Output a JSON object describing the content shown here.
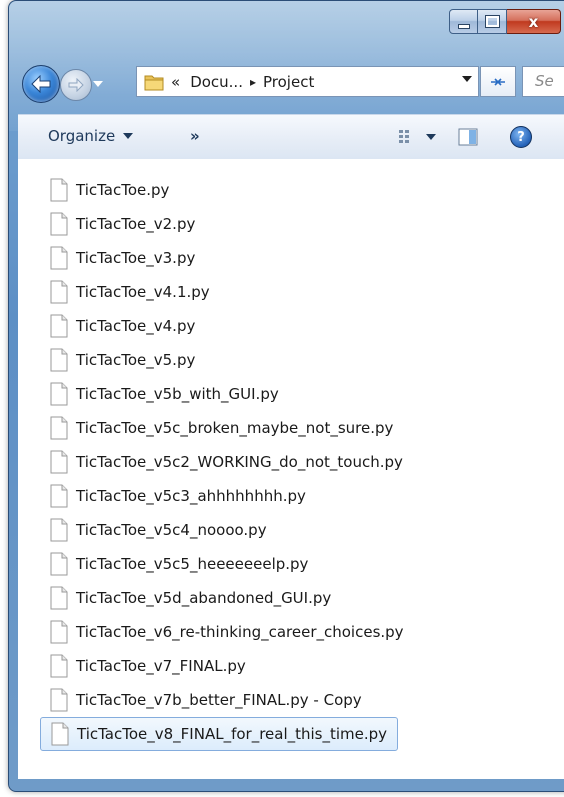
{
  "window": {
    "caption_buttons": {
      "minimize_icon": "minimize-icon",
      "maximize_icon": "maximize-icon",
      "close_label": "x"
    }
  },
  "navigation": {
    "back_icon": "back-arrow-icon",
    "forward_icon": "forward-arrow-icon",
    "breadcrumb_prefix": "«",
    "breadcrumb_segments": [
      "Docu...",
      "Project"
    ],
    "breadcrumb_separator": "▸",
    "refresh_icon": "refresh-icon",
    "search_placeholder": "Se"
  },
  "command_bar": {
    "organize_label": "Organize",
    "more_label": "»",
    "views_icon": "views-icon",
    "preview_pane_icon": "preview-pane-icon",
    "help_label": "?"
  },
  "files": [
    {
      "name": "TicTacToe.py"
    },
    {
      "name": "TicTacToe_v2.py"
    },
    {
      "name": "TicTacToe_v3.py"
    },
    {
      "name": "TicTacToe_v4.1.py"
    },
    {
      "name": "TicTacToe_v4.py"
    },
    {
      "name": "TicTacToe_v5.py"
    },
    {
      "name": "TicTacToe_v5b_with_GUI.py"
    },
    {
      "name": "TicTacToe_v5c_broken_maybe_not_sure.py"
    },
    {
      "name": "TicTacToe_v5c2_WORKING_do_not_touch.py"
    },
    {
      "name": "TicTacToe_v5c3_ahhhhhhhh.py"
    },
    {
      "name": "TicTacToe_v5c4_noooo.py"
    },
    {
      "name": "TicTacToe_v5c5_heeeeeeelp.py"
    },
    {
      "name": "TicTacToe_v5d_abandoned_GUI.py"
    },
    {
      "name": "TicTacToe_v6_re-thinking_career_choices.py"
    },
    {
      "name": "TicTacToe_v7_FINAL.py"
    },
    {
      "name": "TicTacToe_v7b_better_FINAL.py - Copy"
    },
    {
      "name": "TicTacToe_v8_FINAL_for_real_this_time.py",
      "selected": true
    }
  ],
  "colors": {
    "selection_border": "#84acdd",
    "selection_fill": "#dcecfc",
    "frame_blue": "#5d8fc5",
    "close_red": "#c0391f"
  }
}
